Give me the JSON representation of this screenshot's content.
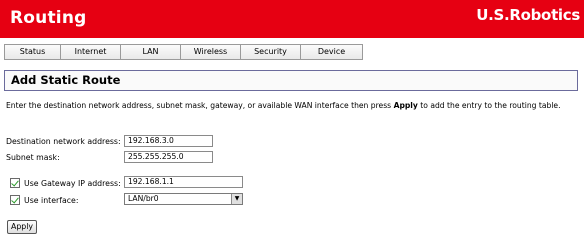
{
  "header": {
    "title": "Routing",
    "brand": "U.S.Robotics"
  },
  "tabs": [
    {
      "label": "Status"
    },
    {
      "label": "Internet"
    },
    {
      "label": "LAN"
    },
    {
      "label": "Wireless"
    },
    {
      "label": "Security"
    },
    {
      "label": "Device"
    }
  ],
  "section": {
    "title": "Add Static Route"
  },
  "description": {
    "before": "Enter the destination network address, subnet mask, gateway, or available WAN interface then press ",
    "bold": "Apply",
    "after": " to add the entry to the routing table."
  },
  "form": {
    "destination_label": "Destination network address:",
    "destination_value": "192.168.3.0",
    "subnet_label": "Subnet mask:",
    "subnet_value": "255.255.255.0",
    "gateway_label": "Use Gateway IP address:",
    "gateway_value": "192.168.1.1",
    "gateway_checked": true,
    "interface_label": "Use interface:",
    "interface_value": "LAN/br0",
    "interface_checked": true
  },
  "buttons": {
    "apply": "Apply"
  },
  "colors": {
    "header_red": "#e60012",
    "check_green": "#2a9a2a"
  }
}
